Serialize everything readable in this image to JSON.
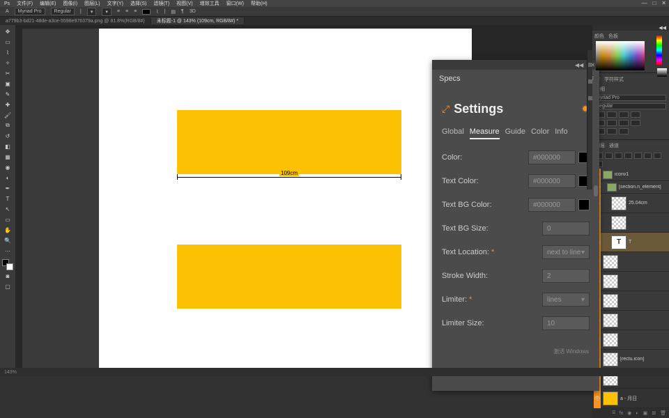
{
  "menus": [
    "文件(F)",
    "编辑(E)",
    "图像(I)",
    "图层(L)",
    "文字(Y)",
    "选择(S)",
    "滤镜(T)",
    "视图(V)",
    "增效工具",
    "窗口(W)",
    "帮助(H)"
  ],
  "win_controls": [
    "—",
    "□",
    "✕"
  ],
  "optbar": {
    "tool": "A",
    "font": "Myriad Pro",
    "style": "Regular"
  },
  "doc_tabs": [
    "a779b3-bd21-48de-a3ce-5598e976379a.png @ 81.8%(RGB/8#)",
    "未标题-1 @ 143% (109cm, RGB/8#) *"
  ],
  "canvas": {
    "measure_label": "109cm"
  },
  "specs": {
    "panel_title": "Specs",
    "settings_title": "Settings",
    "tabs": [
      "Global",
      "Measure",
      "Guide",
      "Color",
      "Info"
    ],
    "active_tab": "Measure",
    "rows": {
      "color": {
        "label": "Color:",
        "value": "#000000"
      },
      "text_color": {
        "label": "Text Color:",
        "value": "#000000"
      },
      "text_bg_color": {
        "label": "Text BG Color:",
        "value": "#000000"
      },
      "text_bg_size": {
        "label": "Text BG Size:",
        "value": "0"
      },
      "text_location": {
        "label": "Text Location:",
        "req": "*",
        "value": "next to line"
      },
      "stroke_width": {
        "label": "Stroke Width:",
        "value": "2"
      },
      "limiter": {
        "label": "Limiter:",
        "req": "*",
        "value": "lines"
      },
      "limiter_size": {
        "label": "Limiter Size:",
        "value": "10"
      }
    }
  },
  "right": {
    "color_tabs": [
      "颜色",
      "色板"
    ],
    "mid_tabs": [
      "字",
      "学符样式"
    ],
    "mid_label": "极细",
    "mid_font": "Myriad Pro",
    "mid_style": "Regular",
    "layers_tabs": [
      "图层",
      "通道"
    ],
    "layers": [
      {
        "type": "group",
        "name": "iconv1"
      },
      {
        "type": "group",
        "name": "[section.n_element]",
        "indent": 1
      },
      {
        "type": "layer",
        "name": "25.04cm",
        "thumb": "checker",
        "indent": 2
      },
      {
        "type": "layer",
        "name": "",
        "thumb": "checker",
        "indent": 2
      },
      {
        "type": "layer",
        "name": "T",
        "thumb": "t",
        "sel": true,
        "indent": 2
      },
      {
        "type": "layer",
        "name": "",
        "thumb": "checker"
      },
      {
        "type": "layer",
        "name": "",
        "thumb": "checker"
      },
      {
        "type": "layer",
        "name": "",
        "thumb": "checker"
      },
      {
        "type": "layer",
        "name": "",
        "thumb": "checker"
      },
      {
        "type": "layer",
        "name": "",
        "thumb": "checker"
      },
      {
        "type": "layer",
        "name": "[rectu.icon]",
        "thumb": "checker"
      },
      {
        "type": "layer",
        "name": "",
        "thumb": "checker"
      },
      {
        "type": "layer",
        "name": "a - 月日",
        "thumb": "yellow"
      }
    ]
  },
  "status": {
    "zoom": "143%"
  },
  "watermark": "激活 Windows"
}
